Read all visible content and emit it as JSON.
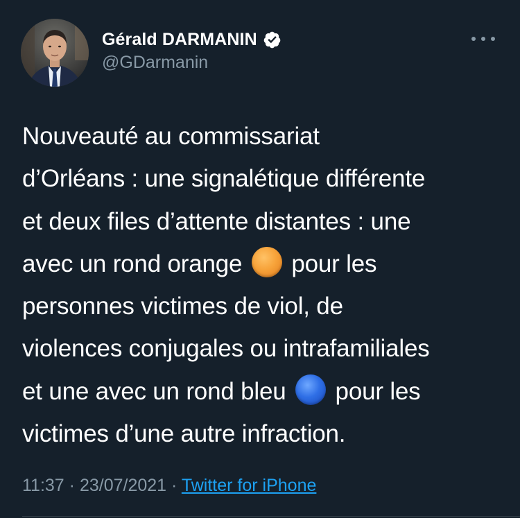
{
  "author": {
    "name": "Gérald DARMANIN",
    "handle": "@GDarmanin",
    "verified": true
  },
  "tweet": {
    "lines": [
      {
        "parts": [
          "Nouveauté au commissariat"
        ]
      },
      {
        "parts": [
          "d’Orléans : une signalétique différente"
        ]
      },
      {
        "parts": [
          "et deux files d’attente distantes : une"
        ]
      },
      {
        "parts": [
          "avec un rond orange",
          " pour les"
        ],
        "emoji": "orange-circle-emoji"
      },
      {
        "parts": [
          "personnes victimes de viol, de"
        ]
      },
      {
        "parts": [
          "violences conjugales ou intrafamiliales"
        ]
      },
      {
        "parts": [
          "et une avec un rond bleu",
          " pour les"
        ],
        "emoji": "blue-circle-emoji"
      },
      {
        "parts": [
          "victimes d’une autre infraction."
        ]
      }
    ],
    "time": "11:37",
    "separator": "·",
    "date": "23/07/2021",
    "source": "Twitter for iPhone"
  },
  "icons": {
    "more": "more-options-icon",
    "verified": "verified-badge-icon"
  },
  "colors": {
    "background": "#15202b",
    "text": "#ffffff",
    "secondary": "#8899a6",
    "link": "#1da1f2",
    "verified_badge": "#ffffff",
    "orange_emoji": "#f7a33a",
    "blue_emoji": "#2f6fe6"
  }
}
